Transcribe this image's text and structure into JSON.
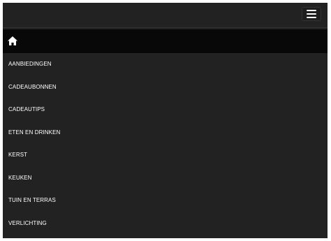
{
  "topbar": {
    "toggle_icon": "hamburger-menu-icon"
  },
  "homebar": {
    "icon": "home-icon"
  },
  "menu": {
    "items": [
      {
        "label": "AANBIEDINGEN"
      },
      {
        "label": "CADEAUBONNEN"
      },
      {
        "label": "CADEAUTIPS"
      },
      {
        "label": "ETEN EN DRINKEN"
      },
      {
        "label": "KERST"
      },
      {
        "label": "KEUKEN"
      },
      {
        "label": "TUIN EN TERRAS"
      },
      {
        "label": "VERLICHTING"
      }
    ]
  },
  "colors": {
    "page_background": "#222222",
    "home_bar": "#080808",
    "text": "#ffffff"
  }
}
